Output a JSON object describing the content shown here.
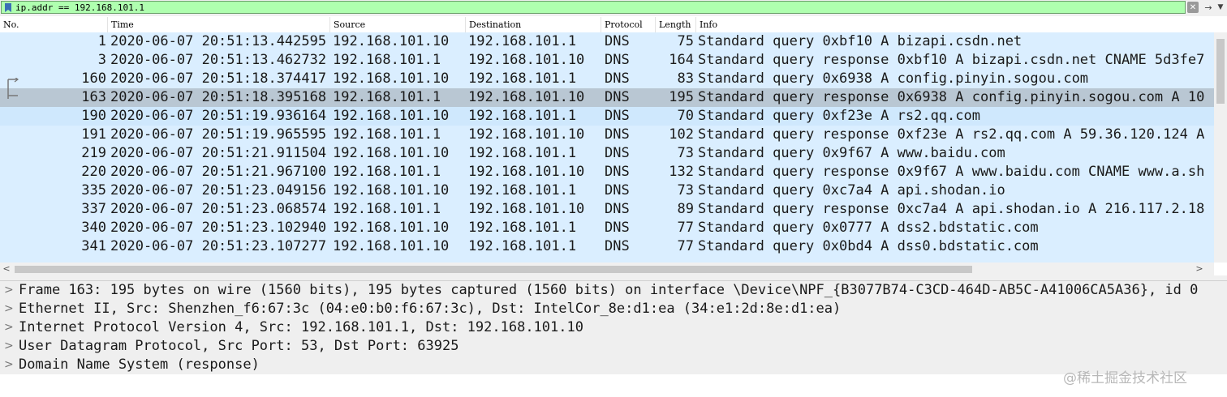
{
  "filter": {
    "value": "ip.addr == 192.168.101.1",
    "background_color": "#afffaf"
  },
  "columns": [
    "No.",
    "Time",
    "Source",
    "Destination",
    "Protocol",
    "Length",
    "Info"
  ],
  "packets": [
    {
      "no": "1",
      "time": "2020-06-07 20:51:13.442595",
      "source": "192.168.101.10",
      "destination": "192.168.101.1",
      "protocol": "DNS",
      "length": "75",
      "info": "Standard query 0xbf10 A bizapi.csdn.net"
    },
    {
      "no": "3",
      "time": "2020-06-07 20:51:13.462732",
      "source": "192.168.101.1",
      "destination": "192.168.101.10",
      "protocol": "DNS",
      "length": "164",
      "info": "Standard query response 0xbf10 A bizapi.csdn.net CNAME 5d3fe7"
    },
    {
      "no": "160",
      "time": "2020-06-07 20:51:18.374417",
      "source": "192.168.101.10",
      "destination": "192.168.101.1",
      "protocol": "DNS",
      "length": "83",
      "info": "Standard query 0x6938 A config.pinyin.sogou.com"
    },
    {
      "no": "163",
      "time": "2020-06-07 20:51:18.395168",
      "source": "192.168.101.1",
      "destination": "192.168.101.10",
      "protocol": "DNS",
      "length": "195",
      "info": "Standard query response 0x6938 A config.pinyin.sogou.com A 10"
    },
    {
      "no": "190",
      "time": "2020-06-07 20:51:19.936164",
      "source": "192.168.101.10",
      "destination": "192.168.101.1",
      "protocol": "DNS",
      "length": "70",
      "info": "Standard query 0xf23e A rs2.qq.com"
    },
    {
      "no": "191",
      "time": "2020-06-07 20:51:19.965595",
      "source": "192.168.101.1",
      "destination": "192.168.101.10",
      "protocol": "DNS",
      "length": "102",
      "info": "Standard query response 0xf23e A rs2.qq.com A 59.36.120.124 A"
    },
    {
      "no": "219",
      "time": "2020-06-07 20:51:21.911504",
      "source": "192.168.101.10",
      "destination": "192.168.101.1",
      "protocol": "DNS",
      "length": "73",
      "info": "Standard query 0x9f67 A www.baidu.com"
    },
    {
      "no": "220",
      "time": "2020-06-07 20:51:21.967100",
      "source": "192.168.101.1",
      "destination": "192.168.101.10",
      "protocol": "DNS",
      "length": "132",
      "info": "Standard query response 0x9f67 A www.baidu.com CNAME www.a.sh"
    },
    {
      "no": "335",
      "time": "2020-06-07 20:51:23.049156",
      "source": "192.168.101.10",
      "destination": "192.168.101.1",
      "protocol": "DNS",
      "length": "73",
      "info": "Standard query 0xc7a4 A api.shodan.io"
    },
    {
      "no": "337",
      "time": "2020-06-07 20:51:23.068574",
      "source": "192.168.101.1",
      "destination": "192.168.101.10",
      "protocol": "DNS",
      "length": "89",
      "info": "Standard query response 0xc7a4 A api.shodan.io A 216.117.2.18"
    },
    {
      "no": "340",
      "time": "2020-06-07 20:51:23.102940",
      "source": "192.168.101.10",
      "destination": "192.168.101.1",
      "protocol": "DNS",
      "length": "77",
      "info": "Standard query 0x0777 A dss2.bdstatic.com"
    },
    {
      "no": "341",
      "time": "2020-06-07 20:51:23.107277",
      "source": "192.168.101.10",
      "destination": "192.168.101.1",
      "protocol": "DNS",
      "length": "77",
      "info": "Standard query 0x0bd4 A dss0.bdstatic.com"
    }
  ],
  "selected_packet": "163",
  "details": [
    "Frame 163: 195 bytes on wire (1560 bits), 195 bytes captured (1560 bits) on interface \\Device\\NPF_{B3077B74-C3CD-464D-AB5C-A41006CA5A36}, id 0",
    "Ethernet II, Src: Shenzhen_f6:67:3c (04:e0:b0:f6:67:3c), Dst: IntelCor_8e:d1:ea (34:e1:2d:8e:d1:ea)",
    "Internet Protocol Version 4, Src: 192.168.101.1, Dst: 192.168.101.10",
    "User Datagram Protocol, Src Port: 53, Dst Port: 63925",
    "Domain Name System (response)"
  ],
  "watermark": "@稀土掘金技术社区",
  "colors": {
    "row_background": "#daeeff",
    "selected_row": "#b9c7d3",
    "detail_background": "#efefef"
  },
  "icons": [
    "bookmark-icon",
    "clear-filter-icon",
    "apply-filter-arrow-icon",
    "filter-dropdown-icon",
    "related-packet-icon"
  ]
}
